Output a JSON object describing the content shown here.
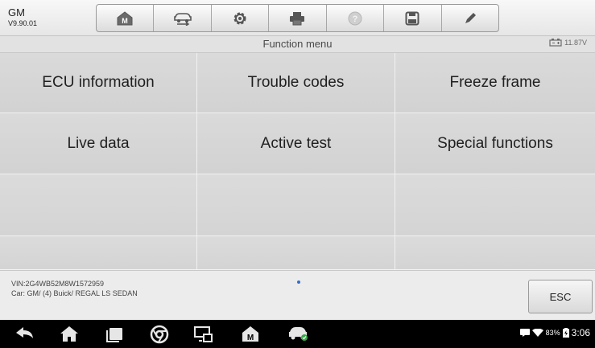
{
  "app": {
    "make": "GM",
    "version": "V9.90.01"
  },
  "toolbar": {
    "buttons": [
      {
        "icon": "home-m-icon"
      },
      {
        "icon": "vehicle-swap-icon"
      },
      {
        "icon": "gear-icon"
      },
      {
        "icon": "printer-icon"
      },
      {
        "icon": "help-icon",
        "disabled": true
      },
      {
        "icon": "save-icon"
      },
      {
        "icon": "pen-icon"
      }
    ]
  },
  "titlebar": {
    "title": "Function menu",
    "battery": "11.87V"
  },
  "menu": {
    "items": [
      "ECU information",
      "Trouble codes",
      "Freeze frame",
      "Live data",
      "Active test",
      "Special functions"
    ]
  },
  "footer": {
    "vin": "VIN:2G4WB52M8W1572959",
    "car": "Car: GM/ (4) Buick/ REGAL LS SEDAN",
    "esc_label": "ESC"
  },
  "status": {
    "battery": "83%",
    "time": "3:06"
  },
  "colors": {
    "accent": "#2f6fd1",
    "navbar": "#000000"
  }
}
